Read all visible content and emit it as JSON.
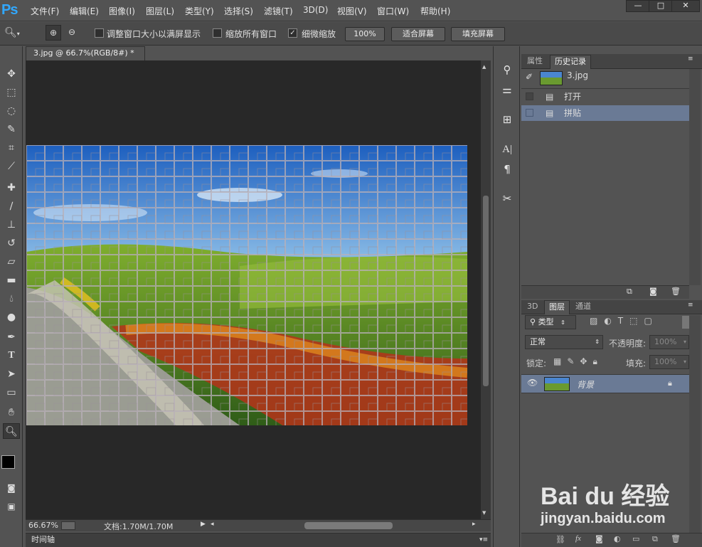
{
  "app": {
    "logo": "Ps"
  },
  "menu": [
    "文件(F)",
    "编辑(E)",
    "图像(I)",
    "图层(L)",
    "类型(Y)",
    "选择(S)",
    "滤镜(T)",
    "3D(D)",
    "视图(V)",
    "窗口(W)",
    "帮助(H)"
  ],
  "window_controls": {
    "minimize": "—",
    "maximize": "□",
    "close": "✕"
  },
  "options": {
    "resize_windows": {
      "label": "调整窗口大小以满屏显示",
      "checked": false
    },
    "zoom_all": {
      "label": "缩放所有窗口",
      "checked": false
    },
    "scrubby_zoom": {
      "label": "细微缩放",
      "checked": true
    },
    "btn_100": "100%",
    "btn_fit": "适合屏幕",
    "btn_fill": "填充屏幕"
  },
  "document": {
    "tab_title": "3.jpg @ 66.7%(RGB/8#) *",
    "tab_close": "×"
  },
  "status": {
    "zoom": "66.67%",
    "doc_info": "文档:1.70M/1.70M"
  },
  "timeline": {
    "label": "时间轴"
  },
  "history_panel": {
    "tabs": [
      "属性",
      "历史记录"
    ],
    "active_tab": "历史记录",
    "snapshot": "3.jpg",
    "items": [
      "打开",
      "拼贴"
    ],
    "selected": "拼贴"
  },
  "layers_panel": {
    "tabs": [
      "3D",
      "图层",
      "通道"
    ],
    "active_tab": "图层",
    "filter_label": "类型",
    "blend_mode": "正常",
    "opacity_label": "不透明度:",
    "opacity_value": "100%",
    "lock_label": "锁定:",
    "fill_label": "填充:",
    "fill_value": "100%",
    "layer_name": "背景"
  },
  "watermark": {
    "brand": "Bai du 经验",
    "url": "jingyan.baidu.com"
  },
  "colors": {
    "accent": "#31a8ff",
    "selection": "#6a7a95",
    "canvas_bg": "#282828"
  }
}
